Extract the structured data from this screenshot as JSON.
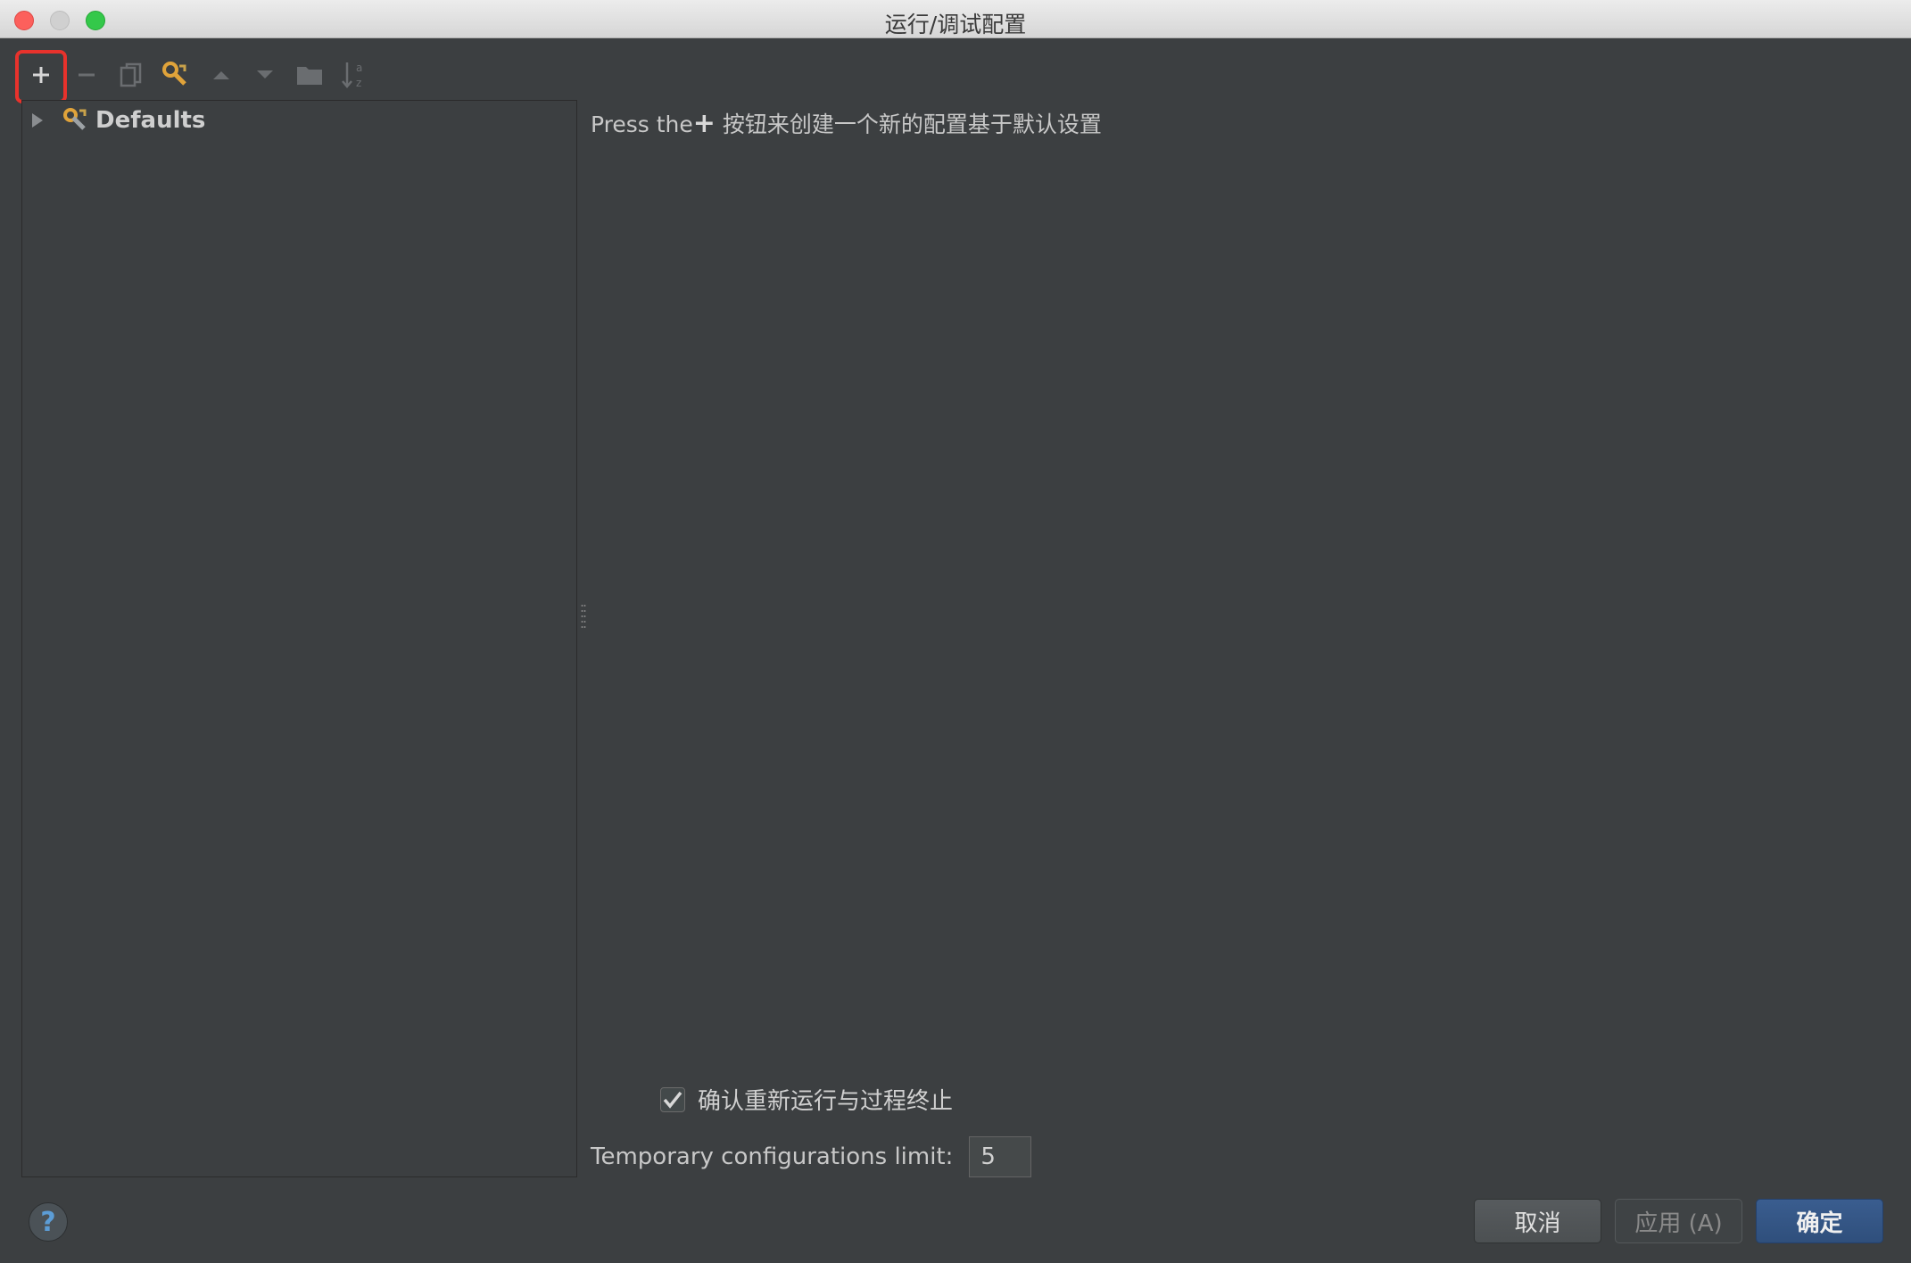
{
  "window": {
    "title": "运行/调试配置"
  },
  "toolbar": {
    "buttons": [
      {
        "icon": "plus-icon",
        "label": "+"
      },
      {
        "icon": "minus-icon",
        "label": "−"
      },
      {
        "icon": "copy-icon"
      },
      {
        "icon": "wrench-icon"
      },
      {
        "icon": "arrow-up-icon"
      },
      {
        "icon": "arrow-down-icon"
      },
      {
        "icon": "folder-icon"
      },
      {
        "icon": "sort-alpha-icon"
      }
    ],
    "highlight_color": "#e8322c"
  },
  "tree": {
    "items": [
      {
        "label": "Defaults",
        "icon": "wrench-icon",
        "expanded": false
      }
    ]
  },
  "main": {
    "hint_prefix": "Press the",
    "hint_plus": "+",
    "hint_suffix": " 按钮来创建一个新的配置基于默认设置",
    "confirm_checkbox": {
      "label": "确认重新运行与过程终止",
      "checked": true
    },
    "temp_limit": {
      "label": "Temporary configurations limit:",
      "value": "5"
    }
  },
  "footer": {
    "help_label": "?",
    "cancel_label": "取消",
    "apply_label": "应用 (A)",
    "ok_label": "确定"
  },
  "colors": {
    "background": "#3c3f41",
    "accent_ok": "#2f4f7c",
    "icon_orange": "#e0a33a"
  }
}
